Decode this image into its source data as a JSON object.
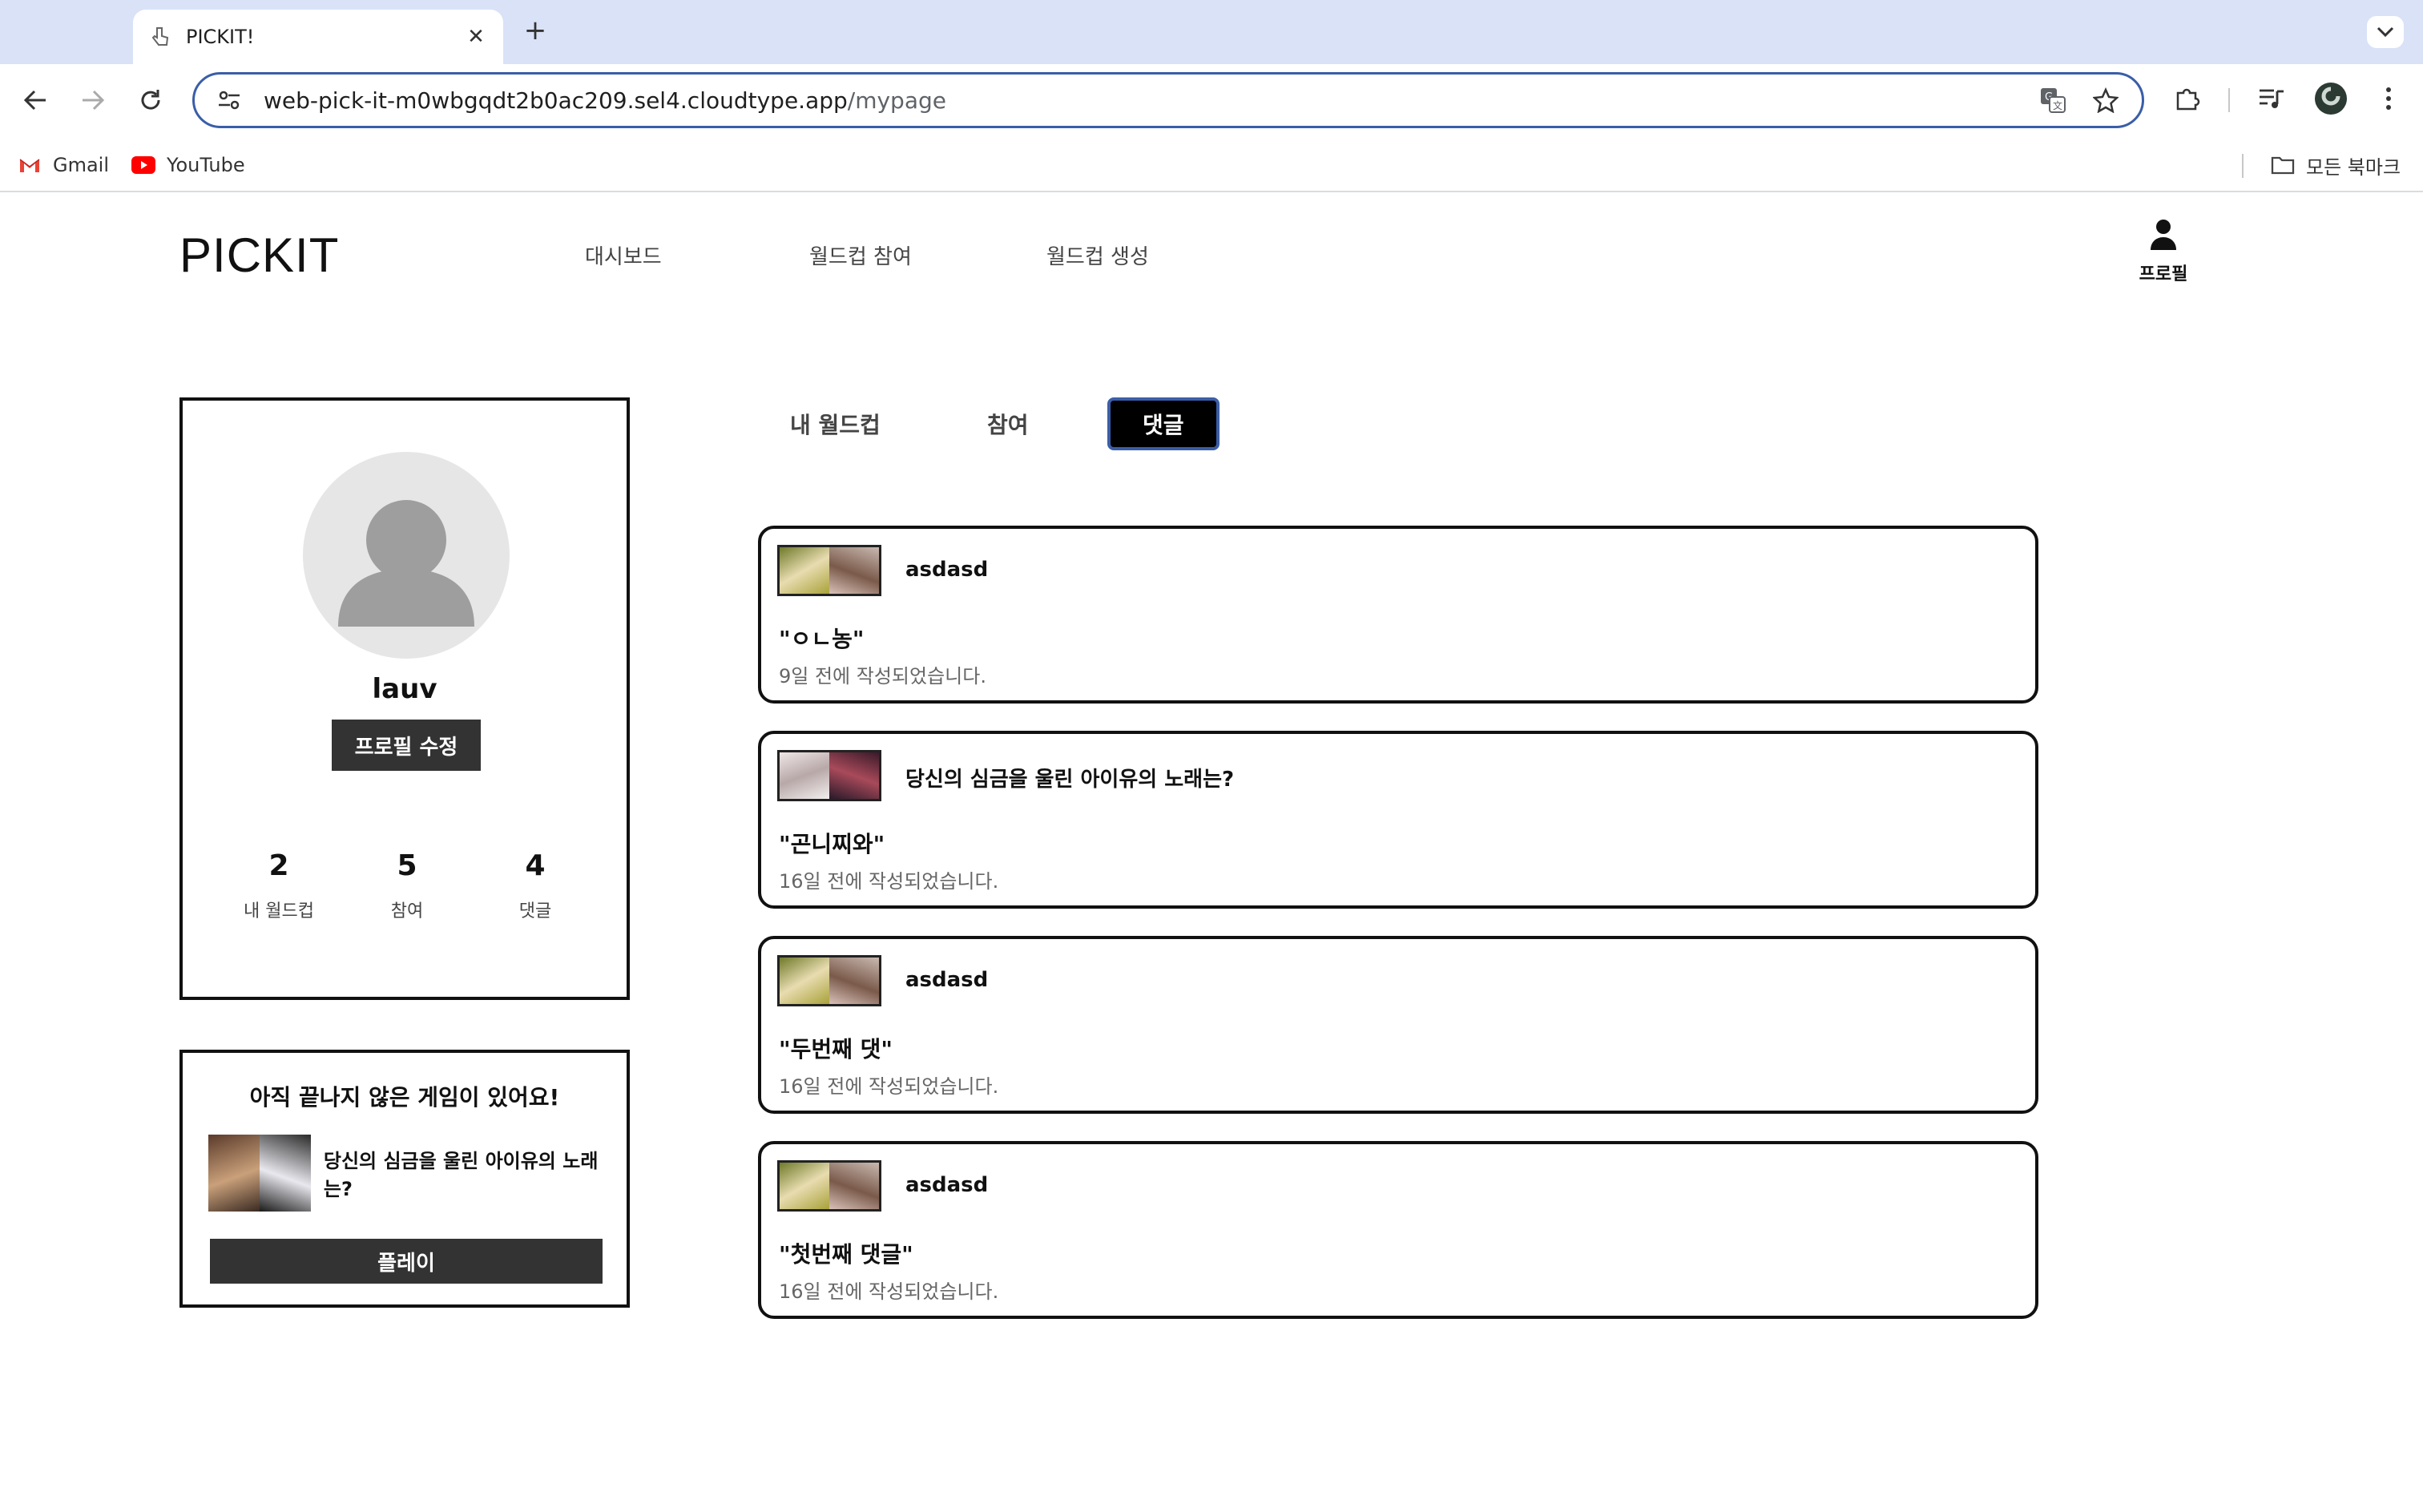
{
  "browser": {
    "tab_title": "PICKIT!",
    "url_host": "web-pick-it-m0wbgqdt2b0ac209.sel4.cloudtype.app",
    "url_path": "/mypage",
    "bookmarks": [
      {
        "label": "Gmail",
        "icon": "gmail-icon"
      },
      {
        "label": "YouTube",
        "icon": "youtube-icon"
      }
    ],
    "all_bookmarks_label": "모든 북마크"
  },
  "header": {
    "brand": "PICKIT",
    "nav": [
      "대시보드",
      "월드컵 참여",
      "월드컵 생성"
    ],
    "profile_label": "프로필"
  },
  "profile": {
    "username": "lauv",
    "edit_label": "프로필 수정",
    "stats": [
      {
        "value": "2",
        "label": "내 월드컵"
      },
      {
        "value": "5",
        "label": "참여"
      },
      {
        "value": "4",
        "label": "댓글"
      }
    ]
  },
  "unfinished": {
    "title": "아직 끝나지 않은 게임이 있어요!",
    "game_name": "당신의 심금을 울린 아이유의 노래는?",
    "play_label": "플레이"
  },
  "tabs": {
    "items": [
      "내 월드컵",
      "참여",
      "댓글"
    ],
    "active": "댓글"
  },
  "comments": [
    {
      "worldcup": "asdasd",
      "text": "\"ㅇㄴ농\"",
      "time": "9일 전에 작성되었습니다.",
      "thumb": [
        "#b9b04a",
        "#8c6a5a"
      ]
    },
    {
      "worldcup": "당신의 심금을 울린 아이유의 노래는?",
      "text": "\"곤니찌와\"",
      "time": "16일 전에 작성되었습니다.",
      "thumb": [
        "#d9c8c8",
        "#5a2a3a"
      ]
    },
    {
      "worldcup": "asdasd",
      "text": "\"두번째 댓\"",
      "time": "16일 전에 작성되었습니다.",
      "thumb": [
        "#b9b04a",
        "#8c6a5a"
      ]
    },
    {
      "worldcup": "asdasd",
      "text": "\"첫번째 댓글\"",
      "time": "16일 전에 작성되었습니다.",
      "thumb": [
        "#b9b04a",
        "#8c6a5a"
      ]
    }
  ],
  "colors": {
    "tabstrip": "#d9e2f7",
    "omnibox_border": "#3a5ea8",
    "dark_button": "#333333",
    "active_tab": "#000000"
  }
}
